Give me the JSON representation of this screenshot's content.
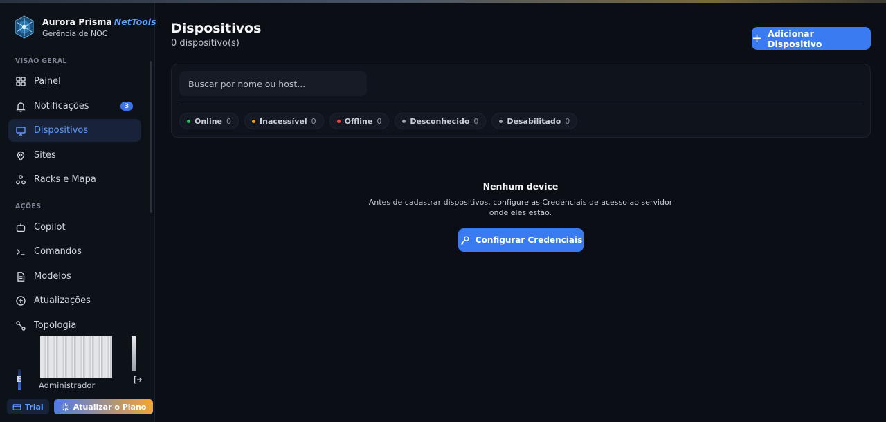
{
  "brand": {
    "name": "Aurora Prisma",
    "product": "NetTools",
    "subtitle": "Gerência de NOC"
  },
  "sidebar": {
    "sections": [
      {
        "label": "VISÃO GERAL"
      },
      {
        "label": "AÇÕES"
      }
    ],
    "items": [
      {
        "label": "Painel",
        "icon": "grid-icon"
      },
      {
        "label": "Notificações",
        "icon": "bell-icon",
        "badge": "3"
      },
      {
        "label": "Dispositivos",
        "icon": "monitor-icon",
        "active": true
      },
      {
        "label": "Sites",
        "icon": "map-pin-icon"
      },
      {
        "label": "Racks e Mapa",
        "icon": "nodes-icon"
      },
      {
        "label": "Copilot",
        "icon": "bot-icon"
      },
      {
        "label": "Comandos",
        "icon": "terminal-icon"
      },
      {
        "label": "Modelos",
        "icon": "document-icon"
      },
      {
        "label": "Atualizações",
        "icon": "arrow-up-circle-icon"
      },
      {
        "label": "Topologia",
        "icon": "topology-icon"
      }
    ]
  },
  "user": {
    "initial": "E",
    "role": "Administrador"
  },
  "plan": {
    "trial_label": "Trial",
    "upgrade_label": "Atualizar o Plano"
  },
  "header": {
    "title": "Dispositivos",
    "count_text": "0 dispositivo(s)",
    "add_button_label": "Adicionar Dispositivo"
  },
  "search": {
    "placeholder": "Buscar por nome ou host..."
  },
  "filters": [
    {
      "label": "Online",
      "count": "0",
      "color": "#22c55e"
    },
    {
      "label": "Inacessível",
      "count": "0",
      "color": "#f59e0b"
    },
    {
      "label": "Offline",
      "count": "0",
      "color": "#ef4444"
    },
    {
      "label": "Desconhecido",
      "count": "0",
      "color": "#9ca3af"
    },
    {
      "label": "Desabilitado",
      "count": "0",
      "color": "#9ca3af"
    }
  ],
  "empty_state": {
    "title": "Nenhum device",
    "description_line1": "Antes de cadastrar dispositivos, configure as Credenciais de acesso ao servidor",
    "description_line2": "onde eles estão.",
    "button_label": "Configurar Credenciais"
  },
  "colors": {
    "accent": "#3b7bf2",
    "active_nav_bg": "#18233a",
    "background": "#0b0e14"
  }
}
